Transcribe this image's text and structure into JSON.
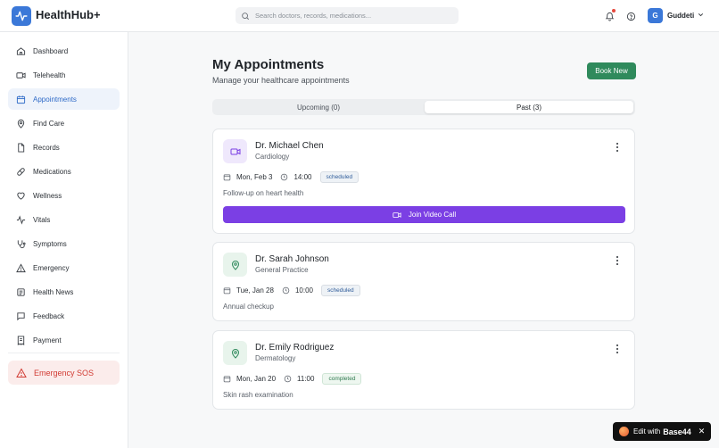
{
  "app": {
    "name": "HealthHub+",
    "brand_color": "#3b78d8"
  },
  "search": {
    "placeholder": "Search doctors, records, medications...",
    "value": ""
  },
  "user": {
    "initial": "G",
    "name": "Guddeti"
  },
  "sidebar": {
    "items": [
      {
        "label": "Dashboard",
        "icon": "home-icon"
      },
      {
        "label": "Telehealth",
        "icon": "video-icon"
      },
      {
        "label": "Appointments",
        "icon": "calendar-icon",
        "active": true
      },
      {
        "label": "Find Care",
        "icon": "map-pin-icon"
      },
      {
        "label": "Records",
        "icon": "file-icon"
      },
      {
        "label": "Medications",
        "icon": "pill-icon"
      },
      {
        "label": "Wellness",
        "icon": "heart-icon"
      },
      {
        "label": "Vitals",
        "icon": "activity-icon"
      },
      {
        "label": "Symptoms",
        "icon": "stethoscope-icon"
      },
      {
        "label": "Emergency",
        "icon": "alert-triangle-icon"
      },
      {
        "label": "Health News",
        "icon": "newspaper-icon"
      },
      {
        "label": "Feedback",
        "icon": "message-icon"
      },
      {
        "label": "Payment",
        "icon": "receipt-icon"
      }
    ],
    "sos_label": "Emergency SOS"
  },
  "main": {
    "title": "My Appointments",
    "subtitle": "Manage your healthcare appointments",
    "book_label": "Book New",
    "tabs": [
      {
        "label": "Upcoming (0)",
        "selected": false
      },
      {
        "label": "Past (3)",
        "selected": true
      }
    ],
    "appointments": [
      {
        "doctor": "Dr. Michael Chen",
        "specialty": "Cardiology",
        "date": "Mon, Feb 3",
        "time": "14:00",
        "status": "scheduled",
        "note": "Follow-up on heart health",
        "type": "video",
        "join_label": "Join Video Call"
      },
      {
        "doctor": "Dr. Sarah Johnson",
        "specialty": "General Practice",
        "date": "Tue, Jan 28",
        "time": "10:00",
        "status": "scheduled",
        "note": "Annual checkup",
        "type": "in-person"
      },
      {
        "doctor": "Dr. Emily Rodriguez",
        "specialty": "Dermatology",
        "date": "Mon, Jan 20",
        "time": "11:00",
        "status": "completed",
        "note": "Skin rash examination",
        "type": "in-person"
      }
    ]
  },
  "edit_badge": {
    "prefix": "Edit with",
    "brand": "Base44",
    "close": "✕"
  },
  "colors": {
    "video_accent": "#7b3fe4",
    "location_accent": "#2f8a5c",
    "book_button": "#2f8a5c",
    "sos": "#d13b33"
  }
}
